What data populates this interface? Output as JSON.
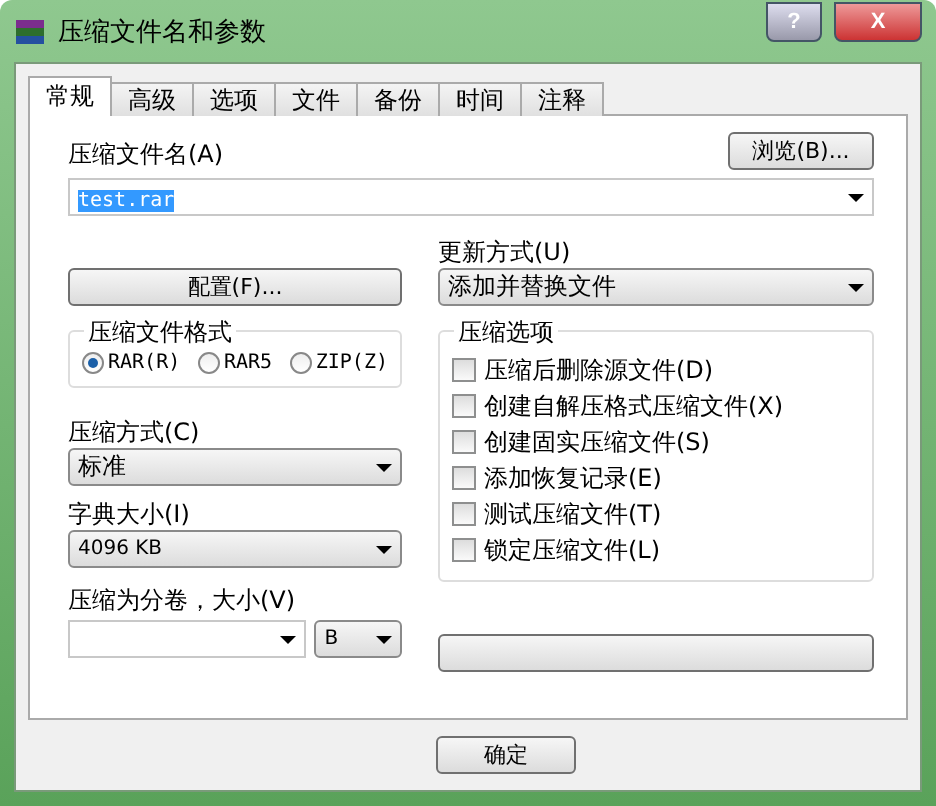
{
  "window": {
    "title": "压缩文件名和参数",
    "buttons": [
      "?",
      "X"
    ]
  },
  "tabs": [
    {
      "label": "常规",
      "selected": true
    },
    {
      "label": "高级",
      "selected": false
    },
    {
      "label": "选项",
      "selected": false
    },
    {
      "label": "文件",
      "selected": false
    },
    {
      "label": "备份",
      "selected": false
    },
    {
      "label": "时间",
      "selected": false
    },
    {
      "label": "注释",
      "selected": false
    }
  ],
  "archive_name": {
    "label": "压缩文件名(A)",
    "value": "test.rar",
    "browse_button": "浏览(B)..."
  },
  "profiles_button": "配置(F)...",
  "update_mode": {
    "label": "更新方式(U)",
    "value": "添加并替换文件"
  },
  "archive_format": {
    "title": "压缩文件格式",
    "options": [
      {
        "label": "RAR(R)",
        "selected": true
      },
      {
        "label": "RAR5",
        "selected": false
      },
      {
        "label": "ZIP(Z)",
        "selected": false
      }
    ]
  },
  "compression_method": {
    "label": "压缩方式(C)",
    "value": "标准"
  },
  "dictionary_size": {
    "label": "字典大小(I)",
    "value": "4096 KB"
  },
  "split_volumes": {
    "label": "压缩为分卷，大小(V)",
    "unit": "B"
  },
  "archiving_options": {
    "title": "压缩选项",
    "items": [
      {
        "label": "压缩后删除源文件(D)",
        "checked": false
      },
      {
        "label": "创建自解压格式压缩文件(X)",
        "checked": false
      },
      {
        "label": "创建固实压缩文件(S)",
        "checked": false
      },
      {
        "label": "添加恢复记录(E)",
        "checked": false
      },
      {
        "label": "测试压缩文件(T)",
        "checked": false
      },
      {
        "label": "锁定压缩文件(L)",
        "checked": false
      }
    ]
  },
  "ok_button": "确定"
}
